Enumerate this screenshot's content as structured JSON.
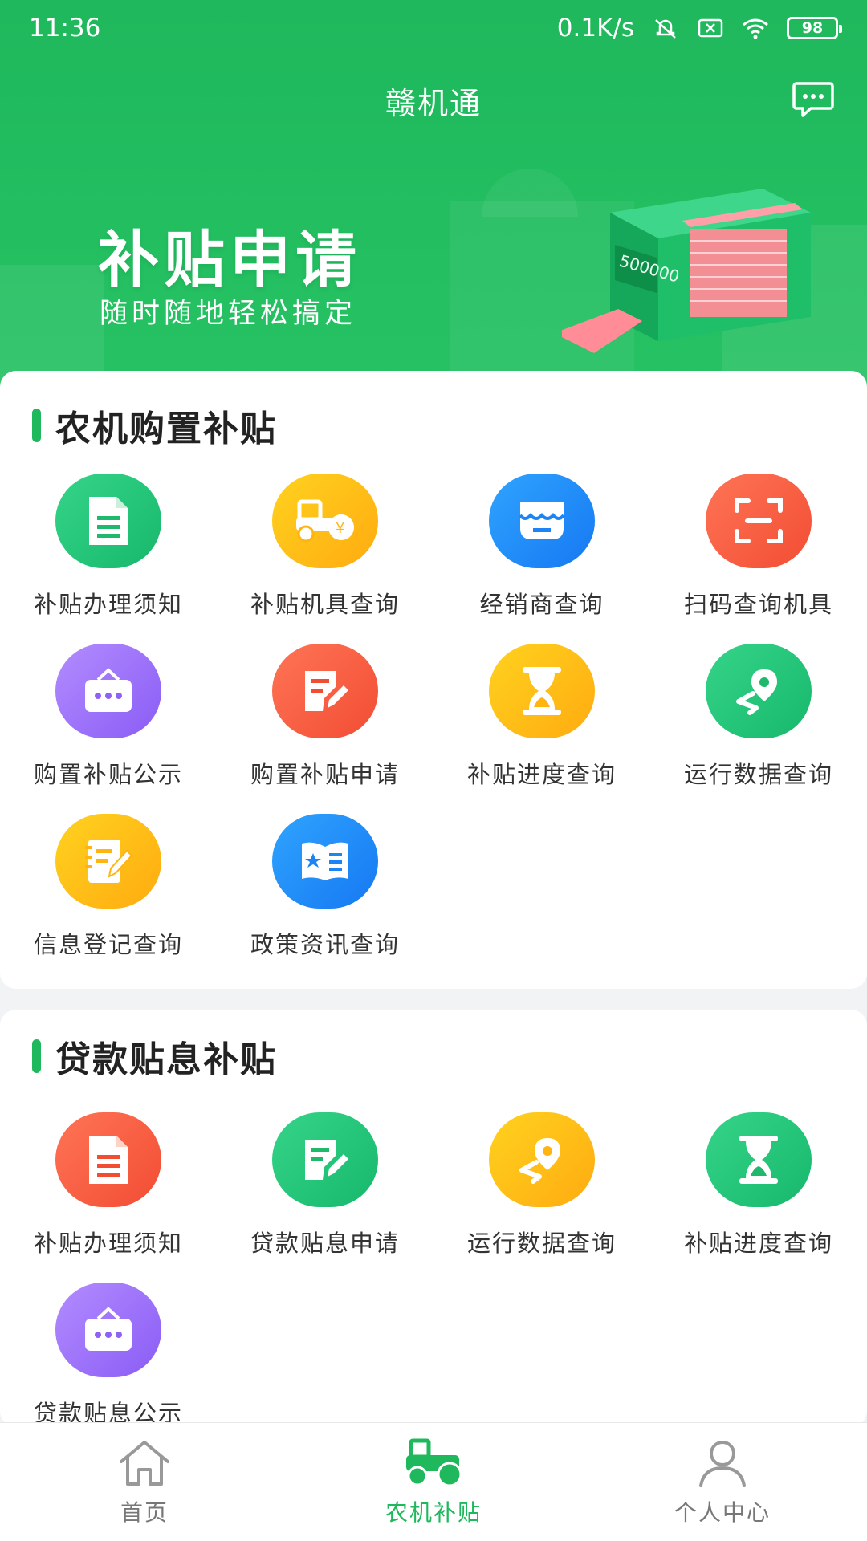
{
  "status_bar": {
    "time": "11:36",
    "network_speed": "0.1K/s",
    "battery_level": "98",
    "icons": [
      "mute-icon",
      "sim-off-icon",
      "wifi-icon",
      "battery-icon"
    ]
  },
  "app": {
    "title": "赣机通",
    "message_icon": "message-icon"
  },
  "banner": {
    "title": "补贴申请",
    "subtitle": "随时随地轻松搞定",
    "machine_text": "500000"
  },
  "sections": [
    {
      "title": "农机购置补贴",
      "items": [
        {
          "label": "补贴办理须知",
          "icon": "document-icon",
          "color": "green"
        },
        {
          "label": "补贴机具查询",
          "icon": "tractor-icon",
          "color": "yellow"
        },
        {
          "label": "经销商查询",
          "icon": "store-icon",
          "color": "blue"
        },
        {
          "label": "扫码查询机具",
          "icon": "scan-icon",
          "color": "red"
        },
        {
          "label": "购置补贴公示",
          "icon": "notice-board-icon",
          "color": "purple"
        },
        {
          "label": "购置补贴申请",
          "icon": "edit-form-icon",
          "color": "red"
        },
        {
          "label": "补贴进度查询",
          "icon": "hourglass-icon",
          "color": "yellow"
        },
        {
          "label": "运行数据查询",
          "icon": "location-route-icon",
          "color": "green"
        },
        {
          "label": "信息登记查询",
          "icon": "notebook-pen-icon",
          "color": "yellow"
        },
        {
          "label": "政策资讯查询",
          "icon": "book-icon",
          "color": "blue"
        }
      ]
    },
    {
      "title": "贷款贴息补贴",
      "items": [
        {
          "label": "补贴办理须知",
          "icon": "document-icon",
          "color": "red"
        },
        {
          "label": "贷款贴息申请",
          "icon": "edit-form-icon",
          "color": "green"
        },
        {
          "label": "运行数据查询",
          "icon": "location-route-icon",
          "color": "yellow"
        },
        {
          "label": "补贴进度查询",
          "icon": "hourglass-icon",
          "color": "green"
        },
        {
          "label": "贷款贴息公示",
          "icon": "notice-board-icon",
          "color": "purple"
        }
      ]
    }
  ],
  "tabbar": {
    "tabs": [
      {
        "label": "首页",
        "icon": "home-icon",
        "active": false
      },
      {
        "label": "农机补贴",
        "icon": "tractor-icon",
        "active": true
      },
      {
        "label": "个人中心",
        "icon": "user-icon",
        "active": false
      }
    ]
  },
  "colors": {
    "brand_green": "#1fb85c",
    "text_dark": "#222222",
    "text_gray": "#777777"
  }
}
